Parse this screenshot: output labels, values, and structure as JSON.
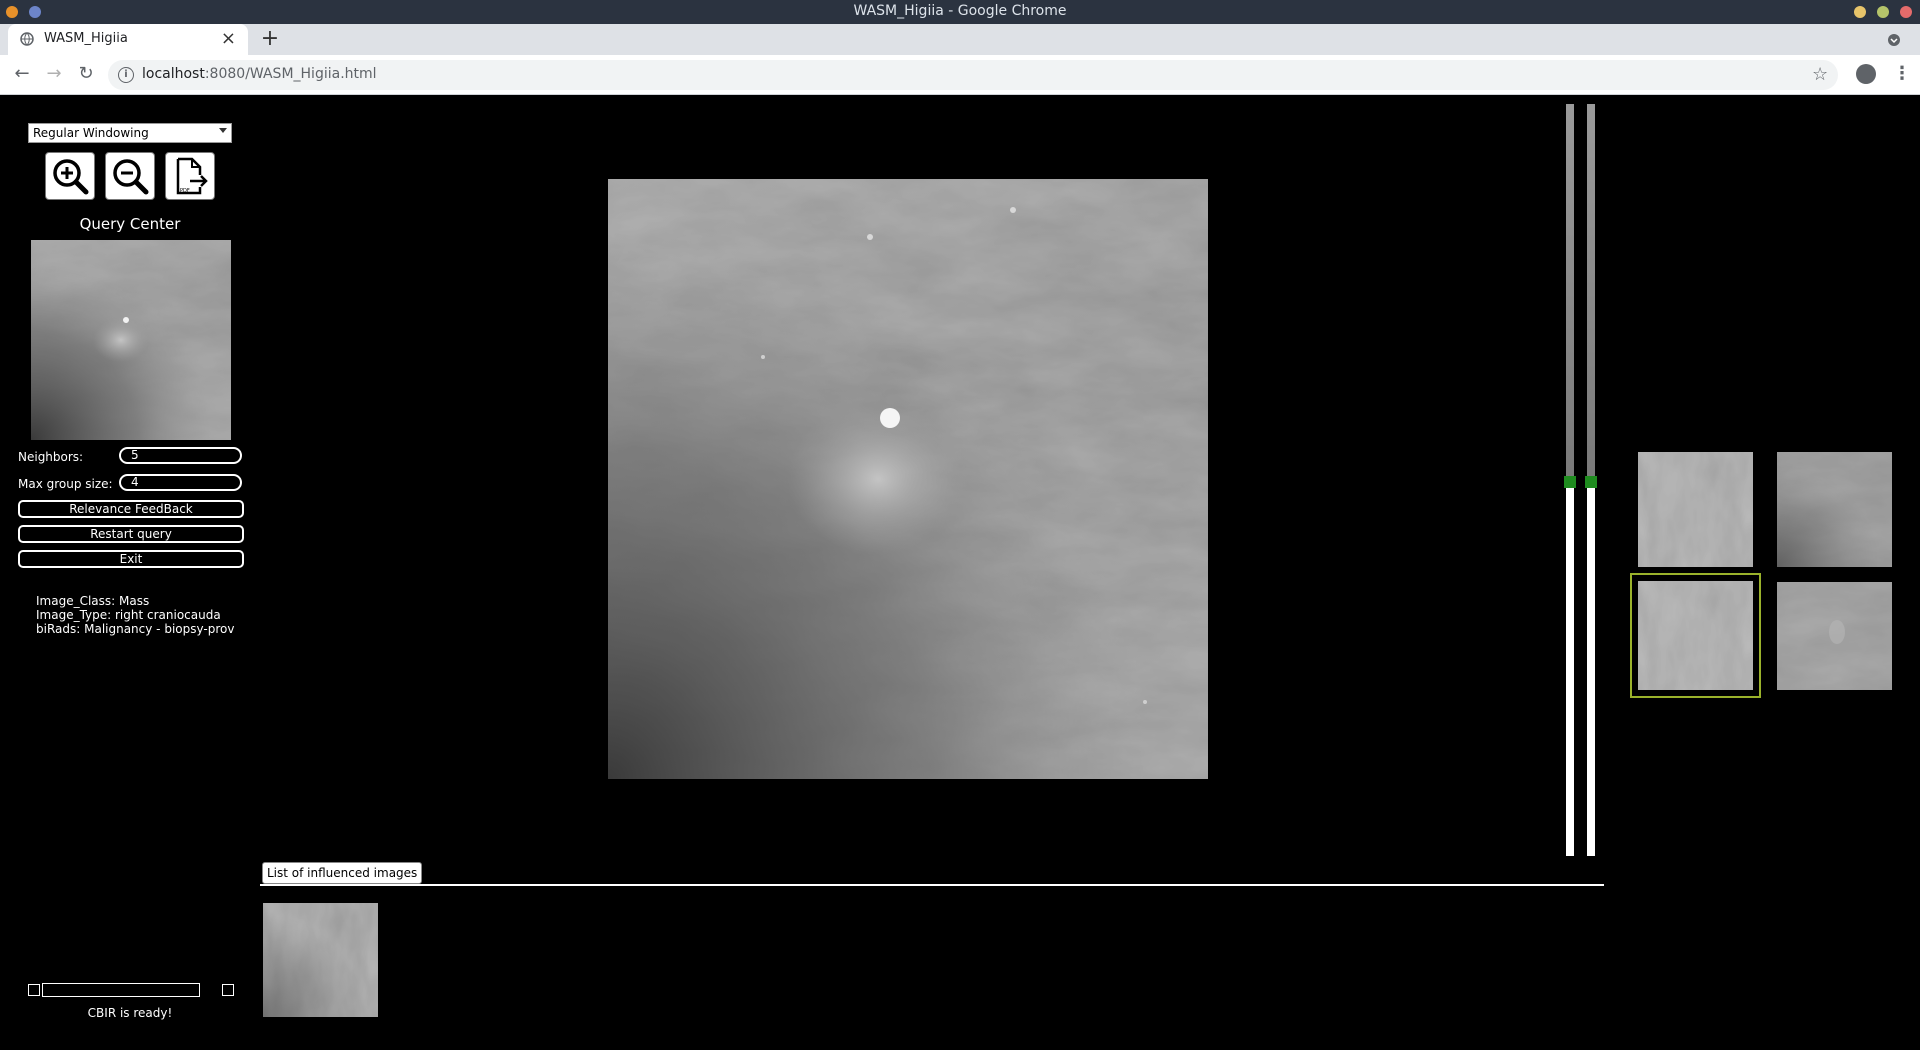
{
  "window": {
    "title": "WASM_Higiia - Google Chrome"
  },
  "browser": {
    "tab_title": "WASM_Higiia",
    "url_host": "localhost",
    "url_path": ":8080/WASM_Higiia.html"
  },
  "app": {
    "windowing_mode": "Regular Windowing",
    "tools": [
      "zoom-in",
      "zoom-out",
      "export-pdf"
    ],
    "query_center_label": "Query Center",
    "neighbors_label": "Neighbors:",
    "neighbors_value": "5",
    "max_group_label": "Max group size:",
    "max_group_value": "4",
    "buttons": {
      "relevance_feedback": "Relevance FeedBack",
      "restart_query": "Restart query",
      "exit": "Exit"
    },
    "info": {
      "image_class": "Image_Class: Mass",
      "image_type": "Image_Type: right craniocauda",
      "birads": "biRads: Malignancy - biopsy-prov"
    },
    "influenced_tab_label": "List of influenced images",
    "status": "CBIR is ready!",
    "window_sliders": {
      "window_level": 0.5,
      "window_width": 0.5
    },
    "accent_green": "#1f8c1f",
    "selection_border": "#9ab22b"
  }
}
